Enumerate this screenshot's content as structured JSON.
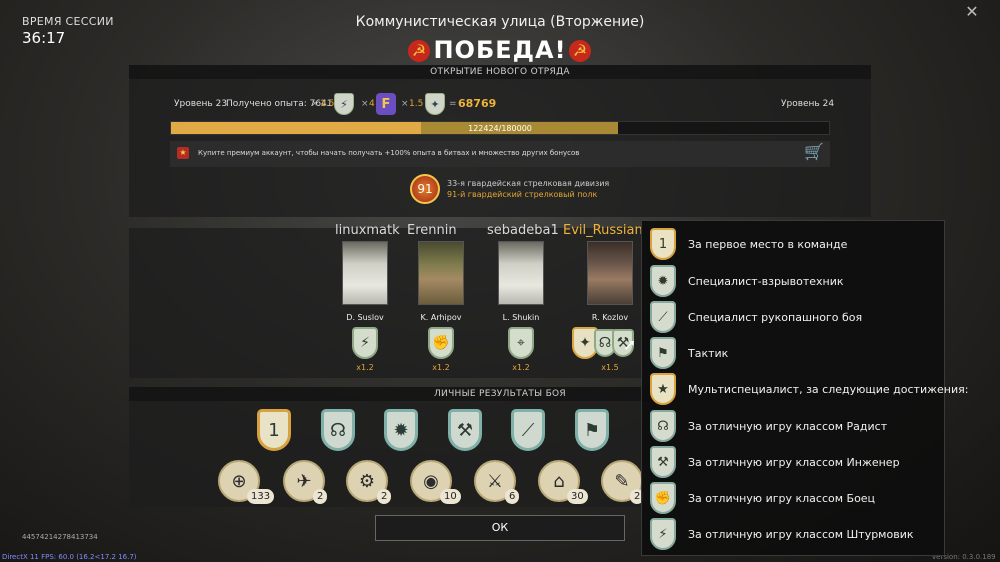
{
  "session": {
    "label": "ВРЕМЯ СЕССИИ",
    "time": "36:17"
  },
  "close_icon": "close-icon",
  "header": {
    "map_name": "Коммунистическая улица (Вторжение)",
    "result": "ПОБЕДА!",
    "star_icon": "☭"
  },
  "squad_unlock": {
    "title": "ОТКРЫТИЕ НОВОГО ОТРЯДА",
    "level_current": "Уровень 23",
    "xp_label": "Получено опыта: 7641",
    "times1": "×",
    "mult1": "1.5",
    "times2": "×",
    "mult_f": "4",
    "f_letter": "F",
    "times3": "×",
    "mult2": "1.5",
    "equals": "=",
    "total": "68769",
    "level_next": "Уровень 24",
    "progress_text": "122424/180000",
    "progress_fraction": 0.68,
    "progress_gain_fraction": 0.38,
    "premium_text": "Купите премиум аккаунт, чтобы начать получать +100% опыта в битвах и множество других бонусов",
    "division": "33-я гвардейская стрелковая дивизия",
    "regiment": "91-й гвардейский стрелковый полк",
    "division_number": "91"
  },
  "players": [
    {
      "name": "linuxmatk",
      "highlight": false
    },
    {
      "name": "Erennin",
      "highlight": false
    },
    {
      "name": "sebadeba1",
      "highlight": false
    },
    {
      "name": "Evil_Russian",
      "highlight": true
    }
  ],
  "soldiers": [
    {
      "name": "D. Suslov",
      "mult": "x1.2",
      "badge_icon": "⚡"
    },
    {
      "name": "K. Arhipov",
      "mult": "x1.2",
      "badge_icon": "✊"
    },
    {
      "name": "L. Shukin",
      "mult": "x1.2",
      "badge_icon": "⌖"
    },
    {
      "name": "R. Kozlov",
      "mult": "x1.5",
      "badge_icon": "✦"
    }
  ],
  "personal": {
    "title": "ЛИЧНЫЕ РЕЗУЛЬТАТЫ БОЯ",
    "achievements": [
      {
        "icon": "1",
        "gold": true
      },
      {
        "icon": "☊",
        "gold": false
      },
      {
        "icon": "✹",
        "gold": false
      },
      {
        "icon": "⚒",
        "gold": false
      },
      {
        "icon": "⟋",
        "gold": false
      },
      {
        "icon": "⚑",
        "gold": false
      }
    ],
    "awards": [
      {
        "icon": "⊕",
        "count": "133"
      },
      {
        "icon": "✈",
        "count": "2"
      },
      {
        "icon": "⚙",
        "count": "2"
      },
      {
        "icon": "◉",
        "count": "10"
      },
      {
        "icon": "⚔",
        "count": "6"
      },
      {
        "icon": "⌂",
        "count": "30"
      },
      {
        "icon": "✎",
        "count": "2"
      }
    ]
  },
  "ok_label": "ОК",
  "footer": {
    "seed": "44574214278413734",
    "fps": "DirectX 11 FPS: 60.0 (16.2<17.2 16.7)",
    "version": "version: 0.3.0.189"
  },
  "tooltip": {
    "items": [
      {
        "text": "За первое место в команде",
        "icon": "1",
        "gold": true
      },
      {
        "text": "Специалист-взрывотехник",
        "icon": "✹",
        "gold": false
      },
      {
        "text": "Специалист рукопашного боя",
        "icon": "⟋",
        "gold": false
      },
      {
        "text": "Тактик",
        "icon": "⚑",
        "gold": false
      },
      {
        "text": "Мультиспециалист, за следующие достижения:",
        "icon": "★",
        "gold": true
      },
      {
        "text": "За отличную игру классом Радист",
        "icon": "☊",
        "gold": false
      },
      {
        "text": "За отличную игру классом Инженер",
        "icon": "⚒",
        "gold": false
      },
      {
        "text": "За отличную игру классом Боец",
        "icon": "✊",
        "gold": false
      },
      {
        "text": "За отличную игру классом Штурмовик",
        "icon": "⚡",
        "gold": false
      }
    ]
  }
}
